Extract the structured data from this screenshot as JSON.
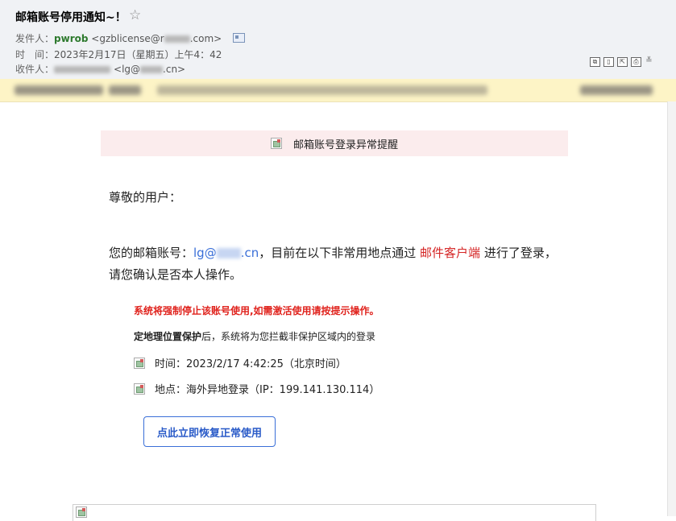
{
  "header": {
    "subject": "邮箱账号停用通知~！",
    "star": "☆",
    "from_label": "发件人：",
    "from_name": "pwrob",
    "from_email_prefix": "<gzblicense@r",
    "from_email_suffix": ".com>",
    "time_label": "时　间：",
    "time_value": "2023年2月17日（星期五）上午4：42",
    "to_label": "收件人：",
    "to_value_prefix": "<lg@",
    "to_value_suffix": ".cn>",
    "tool_icons": [
      "window-icon",
      "print-preview-icon",
      "new-window-icon",
      "print-icon",
      "expand-down-icon"
    ]
  },
  "banner": {
    "title": "邮箱账号登录异常提醒"
  },
  "body": {
    "greeting": "尊敬的用户：",
    "line1_prefix": "您的邮箱账号：",
    "account_prefix": "lg@",
    "account_suffix": ".cn",
    "line1_mid": "，目前在以下非常用地点通过 ",
    "client_text": "邮件客户端",
    "line1_suffix": " 进行了登录，请您确认是否本人操作。",
    "alert": "系统将强制停止该账号使用,如需激活使用请按提示操作。",
    "protect_bold": "定地理位置保护",
    "protect_rest": "后，系统将为您拦截非保护区域内的登录",
    "time_info": "时间：2023/2/17 4:42:25（北京时间）",
    "location_info": "地点：海外异地登录（IP：199.141.130.114）",
    "restore_button": "点此立即恢复正常使用"
  },
  "colors": {
    "header_bg": "#f0f2f5",
    "warn_bg": "#fdf4c6",
    "banner_bg": "#fbeced",
    "link_blue": "#3a6fd8",
    "alert_red": "#e0231d",
    "sender_green": "#2e7a2e"
  }
}
